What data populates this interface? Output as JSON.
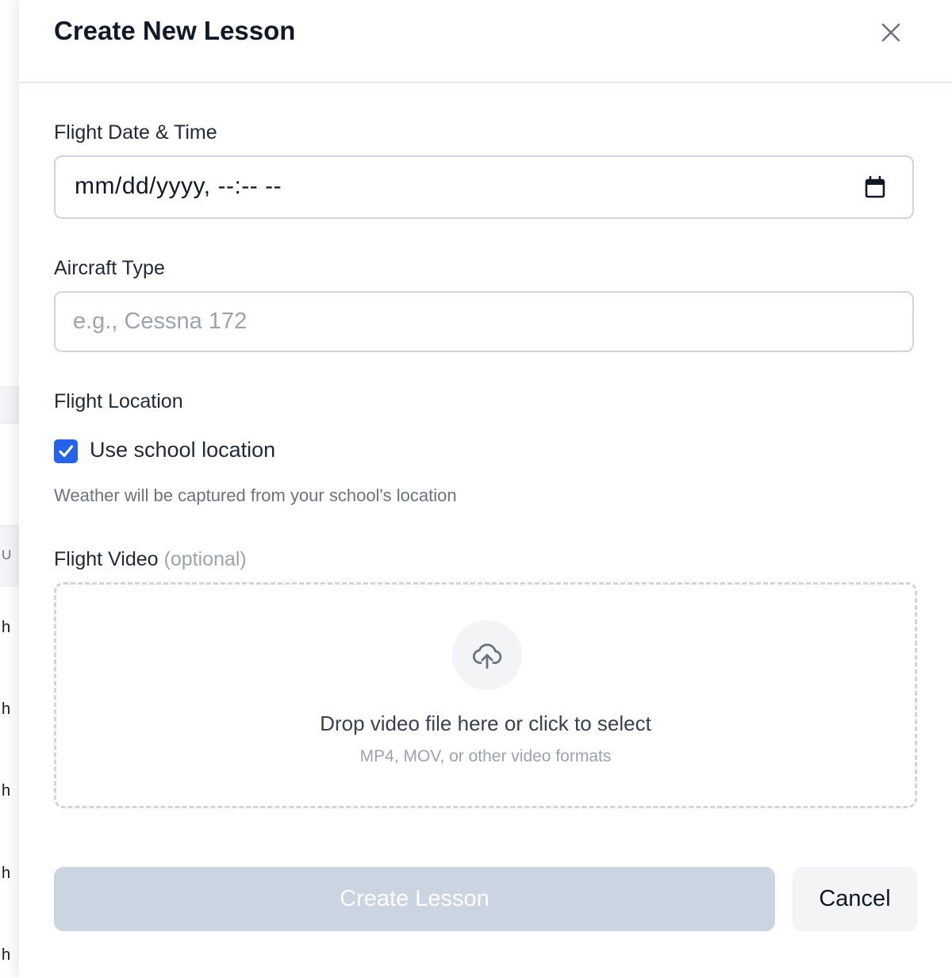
{
  "background": {
    "peek_letters": [
      "U",
      "h",
      "h",
      "h",
      "h",
      "h"
    ]
  },
  "modal": {
    "title": "Create New Lesson",
    "close_icon": "close-icon"
  },
  "fields": {
    "flight_date": {
      "label": "Flight Date & Time",
      "value": "mm/dd/yyyy, --:-- --",
      "icon": "calendar-icon"
    },
    "aircraft_type": {
      "label": "Aircraft Type",
      "placeholder": "e.g., Cessna 172",
      "value": ""
    },
    "flight_location": {
      "label": "Flight Location",
      "checkbox_label": "Use school location",
      "checked": true,
      "helper": "Weather will be captured from your school's location"
    },
    "flight_video": {
      "label": "Flight Video",
      "optional": "(optional)",
      "drop_title": "Drop video file here or click to select",
      "drop_subtitle": "MP4, MOV, or other video formats",
      "icon": "upload-cloud-icon"
    }
  },
  "actions": {
    "create_label": "Create Lesson",
    "create_disabled": true,
    "cancel_label": "Cancel"
  },
  "colors": {
    "accent": "#2563eb",
    "disabled_button": "#cbd5e1",
    "border": "#d1d5db"
  }
}
